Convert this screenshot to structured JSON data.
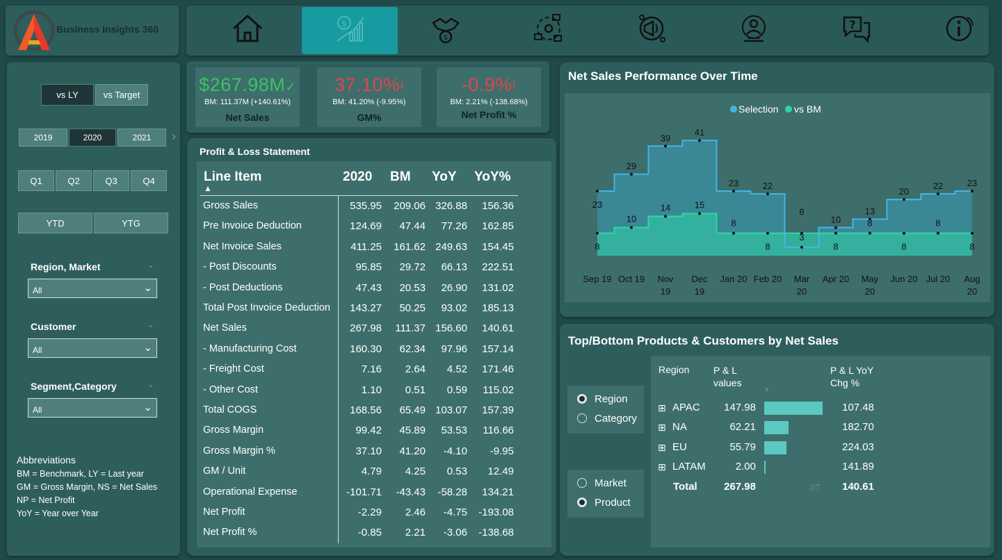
{
  "brand": {
    "title": "Business Insights 360"
  },
  "nav": {
    "items": [
      "home-icon",
      "finance-icon",
      "sales-icon",
      "supply-chain-icon",
      "marketing-icon",
      "executive-icon",
      "support-icon",
      "info-icon"
    ],
    "active_index": 1
  },
  "compare": {
    "vs_ly": "vs LY",
    "vs_target": "vs Target"
  },
  "years": [
    "2019",
    "2020",
    "2021"
  ],
  "year_selected": "2020",
  "quarters": [
    "Q1",
    "Q2",
    "Q3",
    "Q4"
  ],
  "ytd": "YTD",
  "ytg": "YTG",
  "filters": {
    "region": {
      "title": "Region, Market",
      "value": "All"
    },
    "customer": {
      "title": "Customer",
      "value": "All"
    },
    "segment": {
      "title": "Segment,Category",
      "value": "All"
    }
  },
  "abbreviations": {
    "title": "Abbreviations",
    "lines": [
      "BM = Benchmark, LY = Last year",
      "GM = Gross Margin, NS = Net Sales",
      "NP = Net Profit",
      "YoY = Year over Year"
    ]
  },
  "kpis": [
    {
      "value": "$267.98M",
      "flag": "✓",
      "sub": "BM: 111.37M (+140.61%)",
      "label": "Net Sales",
      "color": "#3fc06a"
    },
    {
      "value": "37.10%",
      "flag": "!",
      "sub": "BM: 41.20% (-9.95%)",
      "label": "GM%",
      "color": "#e0454f"
    },
    {
      "value": "-0.9%",
      "flag": "!",
      "sub": "BM: 2.21% (-138.68%)",
      "label": "Net Profit %",
      "color": "#e0454f"
    }
  ],
  "pl": {
    "title": "Profit & Loss Statement",
    "headers": [
      "Line Item",
      "2020",
      "BM",
      "YoY",
      "YoY%"
    ],
    "rows": [
      [
        "Gross Sales",
        "535.95",
        "209.06",
        "326.88",
        "156.36"
      ],
      [
        "Pre Invoice Deduction",
        "124.69",
        "47.44",
        "77.26",
        "162.85"
      ],
      [
        "Net Invoice Sales",
        "411.25",
        "161.62",
        "249.63",
        "154.45"
      ],
      [
        "- Post Discounts",
        "95.85",
        "29.72",
        "66.13",
        "222.51"
      ],
      [
        "- Post Deductions",
        "47.43",
        "20.53",
        "26.90",
        "131.02"
      ],
      [
        "Total Post Invoice Deduction",
        "143.27",
        "50.25",
        "93.02",
        "185.13"
      ],
      [
        "Net Sales",
        "267.98",
        "111.37",
        "156.60",
        "140.61"
      ],
      [
        "- Manufacturing Cost",
        "160.30",
        "62.34",
        "97.96",
        "157.14"
      ],
      [
        "- Freight Cost",
        "7.16",
        "2.64",
        "4.52",
        "171.46"
      ],
      [
        "- Other Cost",
        "1.10",
        "0.51",
        "0.59",
        "115.02"
      ],
      [
        "Total COGS",
        "168.56",
        "65.49",
        "103.07",
        "157.39"
      ],
      [
        "Gross Margin",
        "99.42",
        "45.89",
        "53.53",
        "116.66"
      ],
      [
        "Gross Margin %",
        "37.10",
        "41.20",
        "-4.10",
        "-9.95"
      ],
      [
        "GM / Unit",
        "4.79",
        "4.25",
        "0.53",
        "12.49"
      ],
      [
        "Operational Expense",
        "-101.71",
        "-43.43",
        "-58.28",
        "134.21"
      ],
      [
        "Net Profit",
        "-2.29",
        "2.46",
        "-4.75",
        "-193.08"
      ],
      [
        "Net Profit %",
        "-0.85",
        "2.21",
        "-3.06",
        "-138.68"
      ]
    ]
  },
  "perf": {
    "title": "Net Sales Performance Over Time",
    "legend": [
      "Selection",
      "vs BM"
    ],
    "colors": {
      "selection": "#41b6e6",
      "bm": "#2fd6a8"
    }
  },
  "chart_data": {
    "type": "area",
    "categories": [
      "Sep 19",
      "Oct 19",
      "Nov 19",
      "Dec 19",
      "Jan 20",
      "Feb 20",
      "Mar 20",
      "Apr 20",
      "May 20",
      "Jun 20",
      "Jul 20",
      "Aug 20"
    ],
    "category_lines": [
      [
        "Sep 19"
      ],
      [
        "Oct 19"
      ],
      [
        "Nov",
        "19"
      ],
      [
        "Dec",
        "19"
      ],
      [
        "Jan 20"
      ],
      [
        "Feb 20"
      ],
      [
        "Mar",
        "20"
      ],
      [
        "Apr 20"
      ],
      [
        "May",
        "20"
      ],
      [
        "Jun 20"
      ],
      [
        "Jul 20"
      ],
      [
        "Aug",
        "20"
      ]
    ],
    "series": [
      {
        "name": "Selection",
        "values": [
          23,
          29,
          39,
          41,
          23,
          22,
          3,
          10,
          13,
          20,
          22,
          23
        ]
      },
      {
        "name": "vs BM",
        "values": [
          8,
          10,
          14,
          15,
          8,
          8,
          8,
          8,
          8,
          8,
          8,
          8
        ]
      }
    ],
    "ylim": [
      0,
      45
    ],
    "grid": false,
    "legend_position": "top-center"
  },
  "topbottom": {
    "title": "Top/Bottom Products & Customers by Net Sales",
    "options_a": [
      "Region",
      "Category"
    ],
    "options_a_selected": "Region",
    "options_b": [
      "Market",
      "Product"
    ],
    "options_b_selected": "Product",
    "headers": {
      "region": "Region",
      "values": "P & L\nvalues",
      "chg": "P & L YoY\nChg %"
    },
    "rows": [
      {
        "name": "APAC",
        "value": "147.98",
        "bar": 147.98,
        "chg": "107.48"
      },
      {
        "name": "NA",
        "value": "62.21",
        "bar": 62.21,
        "chg": "182.70"
      },
      {
        "name": "EU",
        "value": "55.79",
        "bar": 55.79,
        "chg": "224.03"
      },
      {
        "name": "LATAM",
        "value": "2.00",
        "bar": 2.0,
        "chg": "141.89"
      }
    ],
    "total": {
      "label": "Total",
      "value": "267.98",
      "mid": "0T",
      "chg": "140.61"
    },
    "bar_color": "#5cc8c2"
  }
}
